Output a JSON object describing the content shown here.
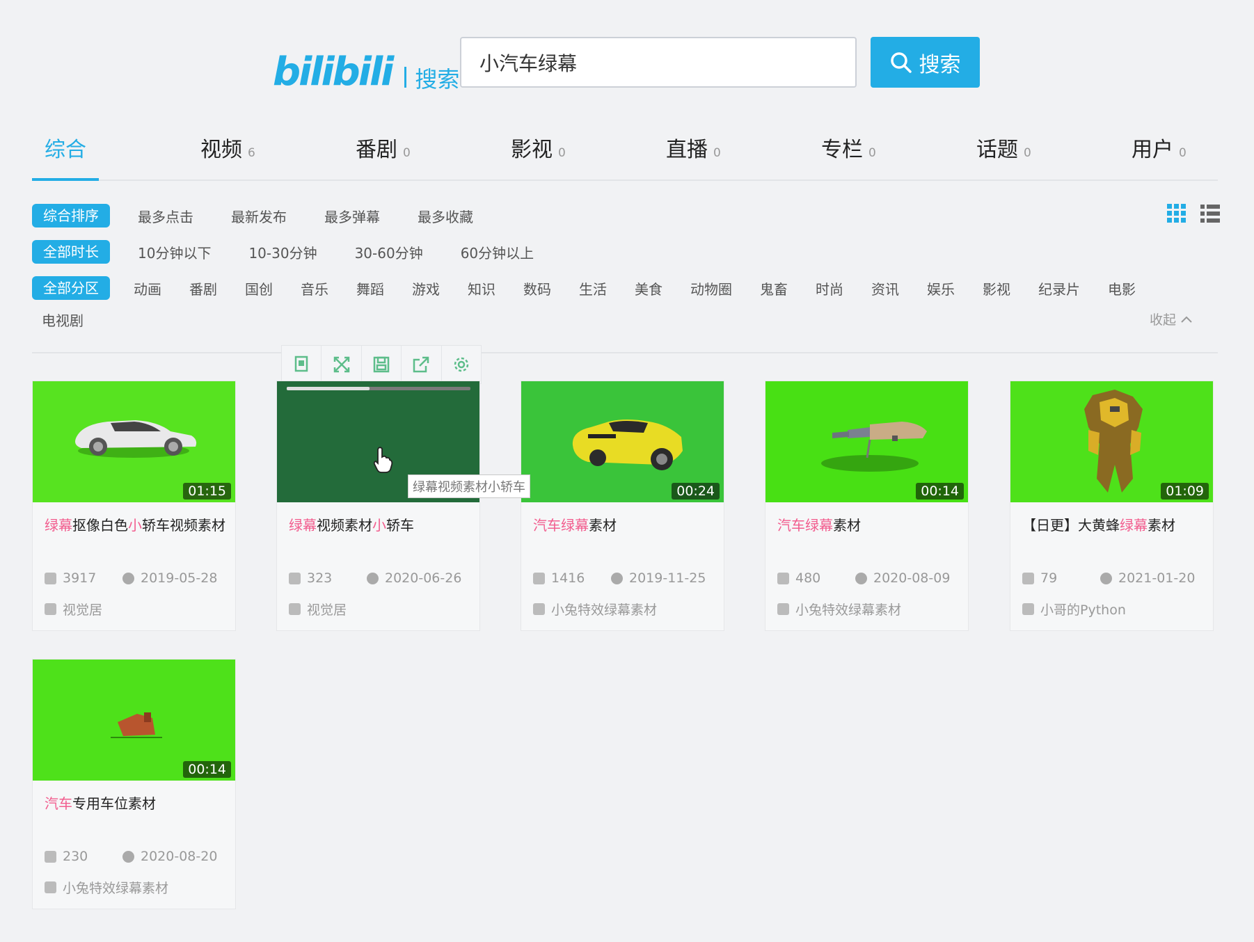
{
  "header": {
    "logo_text": "bilibili",
    "logo_sub": "搜索",
    "search_value": "小汽车绿幕",
    "search_button": "搜索"
  },
  "tabs": [
    {
      "label": "综合",
      "count": ""
    },
    {
      "label": "视频",
      "count": "6"
    },
    {
      "label": "番剧",
      "count": "0"
    },
    {
      "label": "影视",
      "count": "0"
    },
    {
      "label": "直播",
      "count": "0"
    },
    {
      "label": "专栏",
      "count": "0"
    },
    {
      "label": "话题",
      "count": "0"
    },
    {
      "label": "用户",
      "count": "0"
    }
  ],
  "filters": {
    "sort": {
      "active": "综合排序",
      "options": [
        "最多点击",
        "最新发布",
        "最多弹幕",
        "最多收藏"
      ]
    },
    "duration": {
      "active": "全部时长",
      "options": [
        "10分钟以下",
        "10-30分钟",
        "30-60分钟",
        "60分钟以上"
      ]
    },
    "zone": {
      "active": "全部分区",
      "options": [
        "动画",
        "番剧",
        "国创",
        "音乐",
        "舞蹈",
        "游戏",
        "知识",
        "数码",
        "生活",
        "美食",
        "动物圈",
        "鬼畜",
        "时尚",
        "资讯",
        "娱乐",
        "影视",
        "纪录片",
        "电影"
      ],
      "extra": "电视剧"
    },
    "collapse": "收起"
  },
  "player_toolbar": [
    "bookmark-icon",
    "fullscreen-icon",
    "save-icon",
    "share-icon",
    "settings-icon"
  ],
  "tooltip": "绿幕视频素材小轿车",
  "preview_progress": 0.45,
  "videos": [
    {
      "title_parts": [
        {
          "t": "绿幕",
          "h": true
        },
        {
          "t": "抠像白色",
          "h": false
        },
        {
          "t": "小",
          "h": true
        },
        {
          "t": "轿车视频素材",
          "h": false
        }
      ],
      "duration": "01:15",
      "views": "3917",
      "date": "2019-05-28",
      "uploader": "视觉居"
    },
    {
      "title_parts": [
        {
          "t": "绿幕",
          "h": true
        },
        {
          "t": "视频素材",
          "h": false
        },
        {
          "t": "小",
          "h": true
        },
        {
          "t": "轿车",
          "h": false
        }
      ],
      "duration": "",
      "views": "323",
      "date": "2020-06-26",
      "uploader": "视觉居"
    },
    {
      "title_parts": [
        {
          "t": "汽车绿幕",
          "h": true
        },
        {
          "t": "素材",
          "h": false
        }
      ],
      "duration": "00:24",
      "views": "1416",
      "date": "2019-11-25",
      "uploader": "小兔特效绿幕素材"
    },
    {
      "title_parts": [
        {
          "t": "汽车绿幕",
          "h": true
        },
        {
          "t": "素材",
          "h": false
        }
      ],
      "duration": "00:14",
      "views": "480",
      "date": "2020-08-09",
      "uploader": "小兔特效绿幕素材"
    },
    {
      "title_parts": [
        {
          "t": "【日更】大黄蜂",
          "h": false
        },
        {
          "t": "绿幕",
          "h": true
        },
        {
          "t": "素材",
          "h": false
        }
      ],
      "duration": "01:09",
      "views": "79",
      "date": "2021-01-20",
      "uploader": "小哥的Python"
    },
    {
      "title_parts": [
        {
          "t": "汽车",
          "h": true
        },
        {
          "t": "专用车位素材",
          "h": false
        }
      ],
      "duration": "00:14",
      "views": "230",
      "date": "2020-08-20",
      "uploader": "小兔特效绿幕素材"
    }
  ],
  "colors": {
    "accent": "#23ade5",
    "highlight": "#f25d8e",
    "green_screen": "#57e320"
  }
}
